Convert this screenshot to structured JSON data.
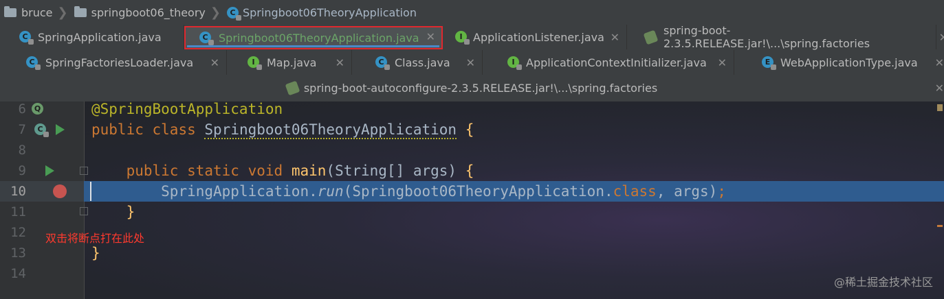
{
  "breadcrumb": {
    "items": [
      "bruce",
      "springboot06_theory",
      "Springboot06TheoryApplication"
    ],
    "separator": "❯"
  },
  "tabs_row1": [
    {
      "label": "SpringApplication.java",
      "icon": "class-icon",
      "icon_glyph": "C"
    },
    {
      "label": "Springboot06TheoryApplication.java",
      "icon": "spring-boot-class-icon",
      "icon_glyph": "C",
      "active": true
    },
    {
      "label": "ApplicationListener.java",
      "icon": "interface-icon",
      "icon_glyph": "I"
    },
    {
      "label": "spring-boot-2.3.5.RELEASE.jar!\\...\\spring.factories",
      "icon": "spring-config-icon",
      "icon_glyph": ""
    }
  ],
  "tabs_row2": [
    {
      "label": "SpringFactoriesLoader.java",
      "icon": "class-icon",
      "icon_glyph": "C"
    },
    {
      "label": "Map.java",
      "icon": "interface-icon",
      "icon_glyph": "I"
    },
    {
      "label": "Class.java",
      "icon": "class-icon",
      "icon_glyph": "C"
    },
    {
      "label": "ApplicationContextInitializer.java",
      "icon": "interface-icon",
      "icon_glyph": "I"
    },
    {
      "label": "WebApplicationType.java",
      "icon": "enum-icon",
      "icon_glyph": "E"
    }
  ],
  "tabs_row3": [
    {
      "label": "spring-boot-autoconfigure-2.3.5.RELEASE.jar!\\...\\spring.factories",
      "icon": "spring-config-icon"
    }
  ],
  "close_glyph": "✕",
  "editor": {
    "line_numbers": [
      "6",
      "7",
      "8",
      "9",
      "10",
      "11",
      "12",
      "13",
      "14"
    ],
    "current_line": "10",
    "code": {
      "l6_annotation": "@SpringBootApplication",
      "l7_kw1": "public",
      "l7_kw2": "class",
      "l7_name": "Springboot06TheoryApplication",
      "l7_brace": "{",
      "l9_kw1": "public",
      "l9_kw2": "static",
      "l9_kw3": "void",
      "l9_method": "main",
      "l9_params": "(String[] args)",
      "l9_brace": "{",
      "l10_recv": "SpringApplication.",
      "l10_call": "run",
      "l10_args_a": "(Springboot06TheoryApplication.",
      "l10_kw": "class",
      "l10_args_b": ", args)",
      "l10_end": ";",
      "l11_brace": "}",
      "l13_brace": "}"
    },
    "annotation_note": "双击将断点打在此处"
  },
  "watermark": "@稀土掘金技术社区",
  "colors": {
    "keyword": "#cc7832",
    "annotation": "#bbb529",
    "method": "#ffc66d",
    "plain": "#a9b7c6",
    "highlight_line": "#2f5c8f",
    "active_tab_text": "#6ba568",
    "active_tab_border": "#e0282e",
    "note": "#ff3a2e"
  }
}
